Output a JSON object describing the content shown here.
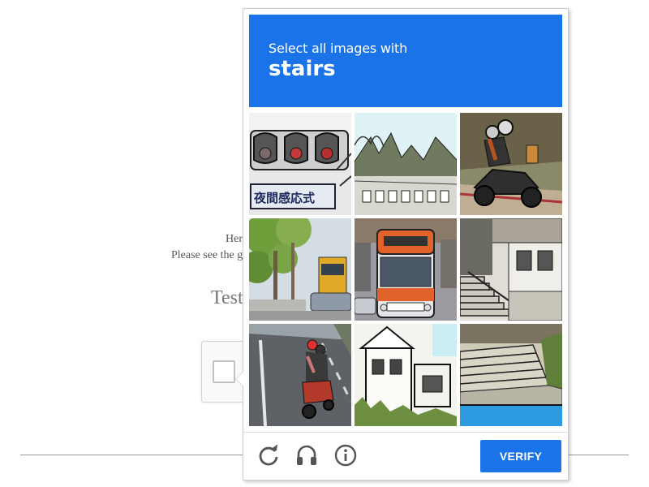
{
  "background_page": {
    "line1": "Her",
    "line2_prefix": "Please see the ",
    "line2_link": "g",
    "heading": "Test"
  },
  "challenge": {
    "instruction": "Select all images with",
    "keyword": "stairs",
    "tiles": [
      {
        "subject": "traffic-light-sign",
        "sign_text": "夜間感応式"
      },
      {
        "subject": "street-crosswalk"
      },
      {
        "subject": "motorcycle-rider"
      },
      {
        "subject": "street-trees-bus"
      },
      {
        "subject": "city-bus"
      },
      {
        "subject": "stairs-building"
      },
      {
        "subject": "motorcycle-road"
      },
      {
        "subject": "house"
      },
      {
        "subject": "stairs-outdoor"
      }
    ],
    "footer": {
      "reload_icon": "reload-icon",
      "audio_icon": "headphones-icon",
      "info_icon": "info-icon",
      "verify_label": "VERIFY"
    }
  },
  "colors": {
    "accent": "#1a73e8",
    "icon_gray": "#555555"
  }
}
